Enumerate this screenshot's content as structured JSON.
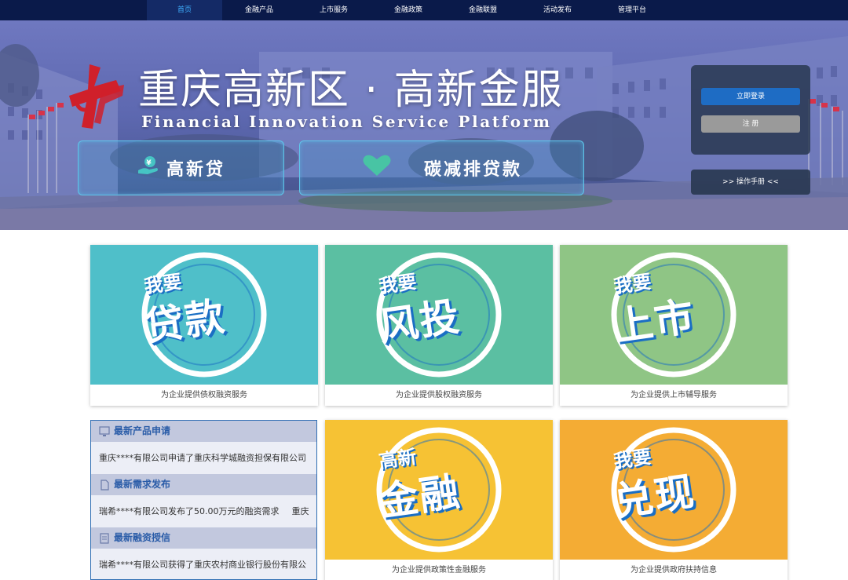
{
  "nav": {
    "items": [
      {
        "label": "首页",
        "active": true
      },
      {
        "label": "金融产品"
      },
      {
        "label": "上市服务"
      },
      {
        "label": "金融政策"
      },
      {
        "label": "金融联盟"
      },
      {
        "label": "活动发布"
      },
      {
        "label": "管理平台"
      }
    ]
  },
  "hero": {
    "title": "重庆高新区 · 高新金服",
    "subtitle": "Financial Innovation Service Platform",
    "btn_loan": "高新贷",
    "btn_carbon": "碳减排贷款",
    "login_label": "立即登录",
    "register_label": "注 册",
    "manual_label": ">> 操作手册 <<"
  },
  "cards": [
    {
      "top": "我要",
      "main": "贷款",
      "caption": "为企业提供债权融资服务",
      "color": "#4fbfc9"
    },
    {
      "top": "我要",
      "main": "风投",
      "caption": "为企业提供股权融资服务",
      "color": "#5bbfa2"
    },
    {
      "top": "我要",
      "main": "上市",
      "caption": "为企业提供上市辅导服务",
      "color": "#8fc585"
    },
    {
      "top": "高新",
      "main": "金融",
      "caption": "为企业提供政策性金融服务",
      "color": "#f6c234"
    },
    {
      "top": "我要",
      "main": "兑现",
      "caption": "为企业提供政府扶持信息",
      "color": "#f4ac34"
    }
  ],
  "news": {
    "sections": [
      {
        "title": "最新产品申请",
        "text": "重庆****有限公司申请了重庆科学城融资担保有限公司",
        "tail": ""
      },
      {
        "title": "最新需求发布",
        "text": "瑞希****有限公司发布了50.00万元的融资需求",
        "tail": "重庆"
      },
      {
        "title": "最新融资授信",
        "text": "瑞希****有限公司获得了重庆农村商业银行股份有限公",
        "tail": ""
      }
    ]
  },
  "colors": {
    "nav_bg": "#0a1a4a",
    "accent": "#1e6cc4",
    "news_title": "#2a5ca8"
  }
}
